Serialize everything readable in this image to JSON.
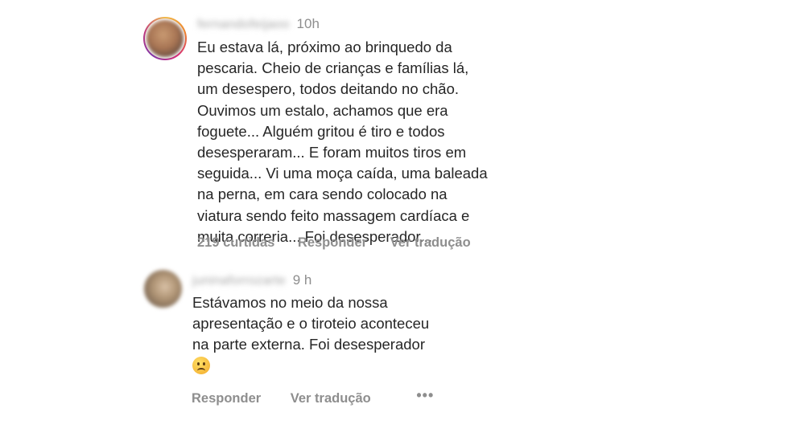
{
  "comments": [
    {
      "username": "fernandofeijaoo",
      "time": "10h",
      "text": "Eu estava lá, próximo ao brinquedo da\npescaria. Cheio de crianças e famílias lá,\num desespero, todos deitando no chão.\nOuvimos um estalo, achamos que era\nfoguete... Alguém gritou é tiro e todos\ndesesperaram... E foram muitos tiros em\nseguida... Vi uma moça caída, uma baleada\nna perna, em cara sendo colocado na\nviatura sendo feito massagem cardíaca e\nmuita correria... Foi desesperador...",
      "likes": "219 curtidas",
      "reply": "Responder",
      "translate": "Ver tradução",
      "avatar_icon": "user-avatar-icon",
      "has_story_ring": true
    },
    {
      "username": "juninaforrozarte",
      "time": "9 h",
      "text": "Estávamos no meio da nossa\napresentação e o tiroteio aconteceu\nna parte externa. Foi desesperador",
      "emoji": "sad-face-emoji",
      "reply": "Responder",
      "translate": "Ver tradução",
      "more": "•••",
      "avatar_icon": "user-avatar-icon",
      "has_story_ring": false
    }
  ],
  "colors": {
    "text": "#262626",
    "secondary": "#8e8e8e",
    "background": "#ffffff"
  }
}
